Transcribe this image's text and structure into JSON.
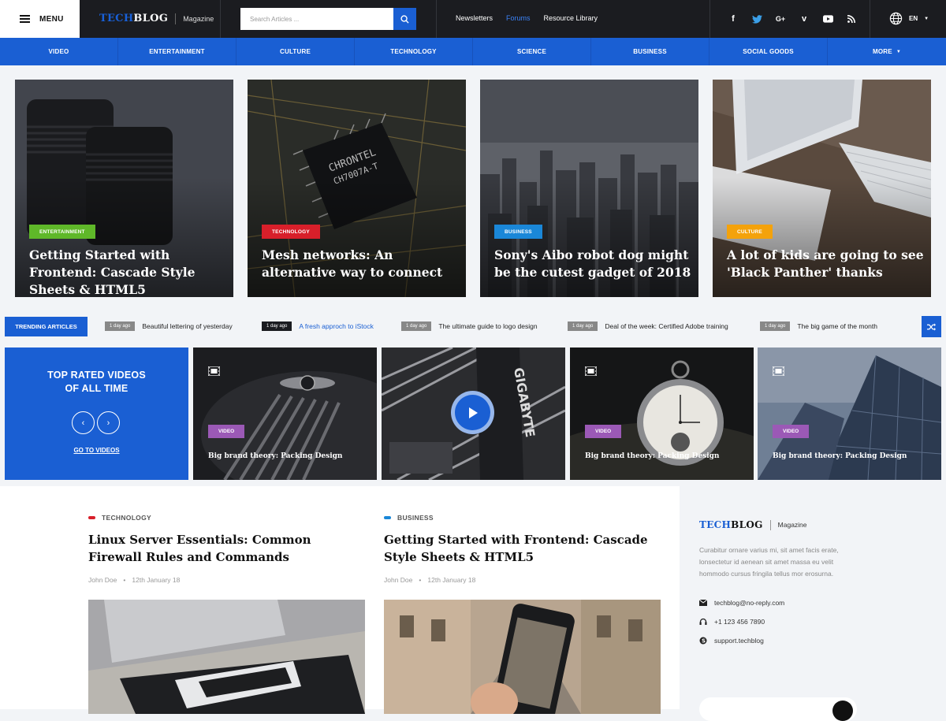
{
  "header": {
    "menu_label": "MENU",
    "logo_part1": "TECH",
    "logo_part2": "BLOG",
    "logo_sub": "Magazine",
    "search_placeholder": "Search Articles ...",
    "links": [
      {
        "label": "Newsletters",
        "active": false
      },
      {
        "label": "Forums",
        "active": true
      },
      {
        "label": "Resource Library",
        "active": false
      }
    ],
    "socials": [
      "facebook-icon",
      "twitter-icon",
      "google-plus-icon",
      "vimeo-icon",
      "youtube-icon",
      "rss-icon"
    ],
    "lang": "EN"
  },
  "nav": {
    "categories": [
      "VIDEO",
      "ENTERTAINMENT",
      "CULTURE",
      "TECHNOLOGY",
      "SCIENCE",
      "BUSINESS",
      "SOCIAL GOODS",
      "MORE"
    ]
  },
  "hero": [
    {
      "category": "ENTERTAINMENT",
      "color": "#5fb829",
      "title": "Getting Started with Frontend: Cascade Style Sheets & HTML5"
    },
    {
      "category": "TECHNOLOGY",
      "color": "#d81f2a",
      "title": "Mesh networks: An alternative way to connect"
    },
    {
      "category": "BUSINESS",
      "color": "#1a87d8",
      "title": "Sony's Aibo robot dog might be the cutest gadget of 2018"
    },
    {
      "category": "CULTURE",
      "color": "#f4a20b",
      "title": "A lot of kids are going to see 'Black Panther' thanks"
    }
  ],
  "trending": {
    "label": "TRENDING ARTICLES",
    "items": [
      {
        "ago": "1 day ago",
        "title": "Beautiful lettering of yesterday"
      },
      {
        "ago": "1 day ago",
        "title": "A fresh approch to iStock"
      },
      {
        "ago": "1 day ago",
        "title": "The ultimate guide to logo design"
      },
      {
        "ago": "1 day ago",
        "title": "Deal of the week: Certified Adobe training"
      },
      {
        "ago": "1 day ago",
        "title": "The big game of the month"
      }
    ]
  },
  "videos": {
    "promo_title_line1": "TOP RATED VIDEOS",
    "promo_title_line2": "OF ALL TIME",
    "promo_link": "GO TO VIDEOS",
    "cards": [
      {
        "badge": "VIDEO",
        "title": "Big brand theory: Packing Design"
      },
      {
        "badge": "",
        "title": ""
      },
      {
        "badge": "VIDEO",
        "title": "Big brand theory: Packing Design"
      },
      {
        "badge": "VIDEO",
        "title": "Big brand theory: Packing Design"
      }
    ]
  },
  "posts": [
    {
      "category": "TECHNOLOGY",
      "color": "#d81f2a",
      "title": "Linux Server Essentials: Common Firewall Rules and Commands",
      "author": "John Doe",
      "date": "12th January 18"
    },
    {
      "category": "BUSINESS",
      "color": "#1a87d8",
      "title": "Getting Started with Frontend: Cascade Style Sheets & HTML5",
      "author": "John Doe",
      "date": "12th January 18"
    }
  ],
  "sidebar": {
    "logo_part1": "TECH",
    "logo_part2": "BLOG",
    "logo_sub": "Magazine",
    "description": "Curabitur ornare varius mi, sit amet facis erate, lonsectetur id aenean sit amet massa eu velit hommodo cursus fringila tellus mor erosurna.",
    "email": "techblog@no-reply.com",
    "phone": "+1 123 456 7890",
    "skype": "support.techblog"
  },
  "colors": {
    "accent": "#1a5fd3",
    "dark": "#1b1c20",
    "video_badge": "#9b59b6"
  }
}
